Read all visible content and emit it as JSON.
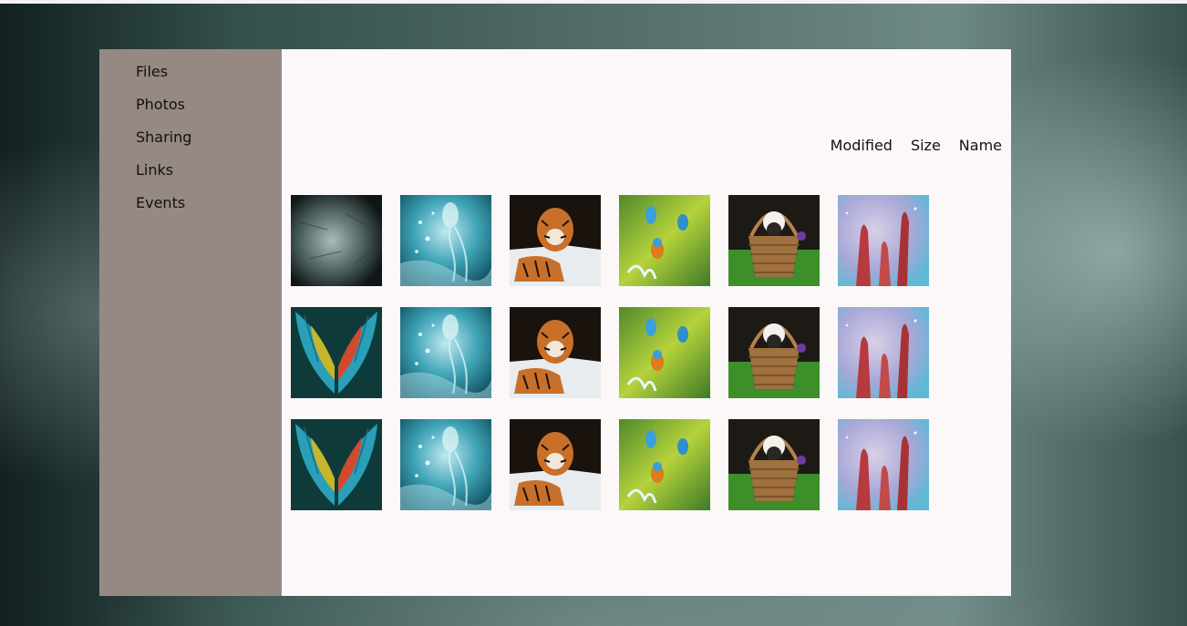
{
  "sidebar": {
    "items": [
      {
        "label": "Files"
      },
      {
        "label": "Photos"
      },
      {
        "label": "Sharing"
      },
      {
        "label": "Links"
      },
      {
        "label": "Events"
      }
    ]
  },
  "sort": {
    "modified_label": "Modified",
    "size_label": "Size",
    "name_label": "Name"
  },
  "photos": [
    [
      "dark-texture",
      "jellyfish",
      "tiger",
      "kingfishers",
      "puppy-basket",
      "nebula"
    ],
    [
      "parrot-wings",
      "jellyfish",
      "tiger",
      "kingfishers",
      "puppy-basket",
      "nebula"
    ],
    [
      "parrot-wings",
      "jellyfish",
      "tiger",
      "kingfishers",
      "puppy-basket",
      "nebula"
    ]
  ],
  "colors": {
    "sidebar": "#968984",
    "main_panel": "#fcf8f7"
  }
}
